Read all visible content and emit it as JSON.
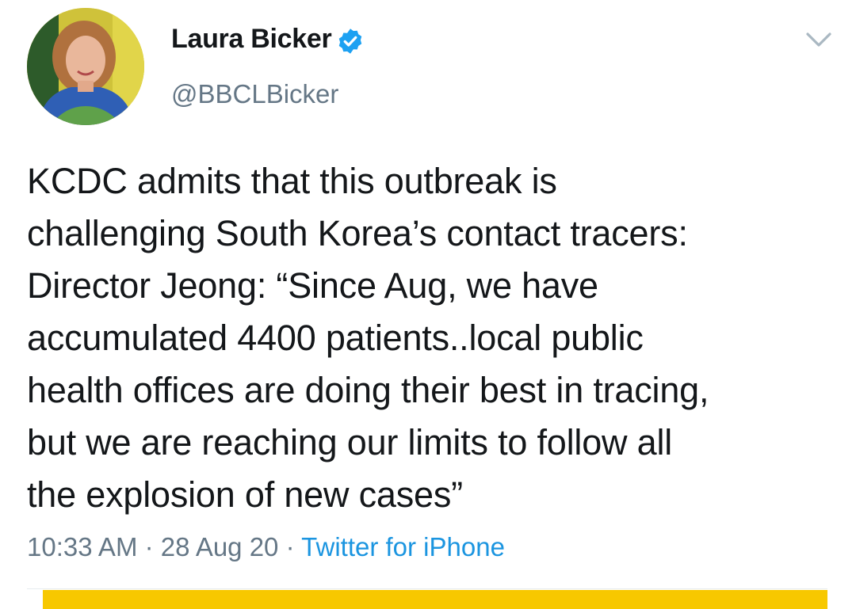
{
  "user": {
    "display_name": "Laura Bicker",
    "handle": "@BBCLBicker",
    "verified": true
  },
  "tweet": {
    "text": "KCDC admits that this outbreak is\nchallenging South Korea’s contact tracers:\nDirector Jeong: “Since Aug, we have\naccumulated 4400 patients..local public\nhealth offices are doing their best in tracing,\nbut we are reaching our limits to follow all\nthe explosion of new cases”",
    "time": "10:33 AM",
    "date": "28 Aug 20",
    "separator": " · ",
    "source": "Twitter for iPhone"
  },
  "icons": {
    "verified": "verified-badge-icon",
    "menu": "chevron-down-icon"
  },
  "colors": {
    "text": "#14171a",
    "secondary": "#657786",
    "link": "#1b95e0",
    "verified": "#1da1f2",
    "accent_bar": "#f7c800"
  }
}
